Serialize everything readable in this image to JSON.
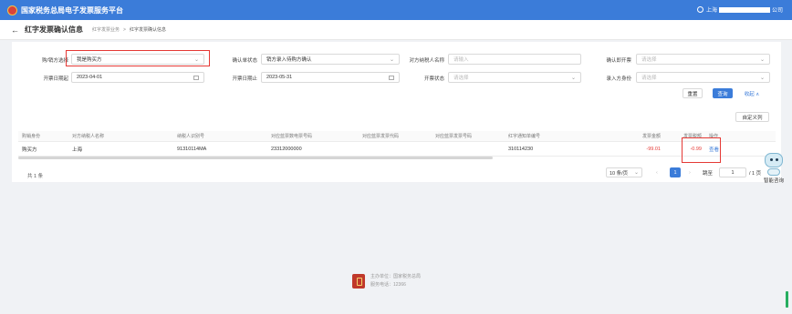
{
  "app": {
    "title": "国家税务总局电子发票服务平台",
    "user_prefix": "上海",
    "user_suffix": "公司"
  },
  "breadcrumb": {
    "back": "←",
    "page_title": "红字发票确认信息",
    "items": [
      "红字发票业务",
      ">",
      "红字发票确认信息"
    ]
  },
  "filters": {
    "buyer_seller": {
      "label": "购/销方选择",
      "value": "我是购买方"
    },
    "confirm_status": {
      "label": "确认单状态",
      "value": "销方录入待购方确认"
    },
    "counterparty_name": {
      "label": "对方纳税人名称",
      "placeholder": "请输入"
    },
    "confirm_rejection": {
      "label": "确认即开票",
      "placeholder": "请选择"
    },
    "date_start": {
      "label": "开票日期起",
      "value": "2023-04-01"
    },
    "date_end": {
      "label": "开票日期止",
      "value": "2023-05-31"
    },
    "invoice_status": {
      "label": "开票状态",
      "placeholder": "请选择"
    },
    "entry_identity": {
      "label": "录入方身份",
      "placeholder": "请选择"
    }
  },
  "actions": {
    "reset": "重置",
    "query": "查询",
    "collapse": "收起 ∧",
    "custom_columns": "自定义列"
  },
  "table": {
    "headers": [
      "购销身份",
      "对方纳税人名称",
      "纳税人识别号",
      "对应蓝票数电票号码",
      "对应蓝票发票代码",
      "对应蓝票发票号码",
      "红字通知单编号",
      "发票金额",
      "发票税额",
      "操作"
    ],
    "rows": [
      {
        "identity": "购买方",
        "name": "上海",
        "tax_id": "91310114MA",
        "blue_invoice_no": "23312000000",
        "blue_code": "",
        "blue_number": "",
        "red_notice_no": "310114230",
        "amount": "-99.01",
        "tax": "-0.99",
        "action": "查看"
      }
    ]
  },
  "pagination": {
    "total": "共 1 条",
    "page_size": "10 条/页",
    "current": "1",
    "jump_label": "跳至",
    "jump_value": "1",
    "pages": "/ 1 页"
  },
  "assistant": {
    "label": "智能咨询"
  },
  "footer": {
    "host": "主办单位：国家税务总局",
    "hotline": "服务电话：12366"
  }
}
